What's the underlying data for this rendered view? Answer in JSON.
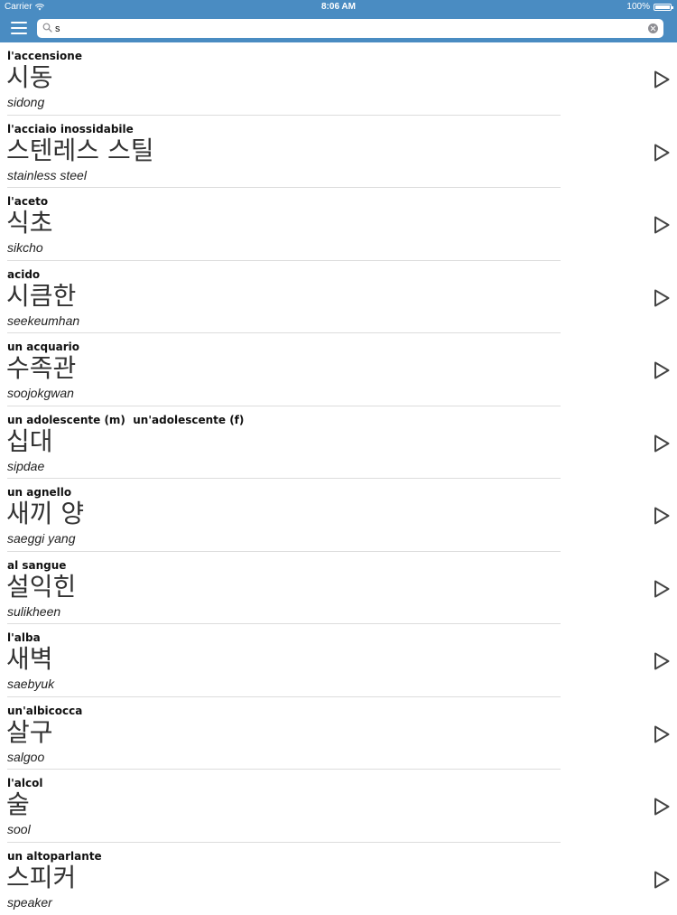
{
  "status_bar": {
    "carrier": "Carrier",
    "time": "8:06 AM",
    "battery": "100%"
  },
  "search": {
    "value": "s",
    "placeholder": ""
  },
  "entries": [
    {
      "italian": "l'accensione",
      "korean": "시동",
      "romanization": "sidong"
    },
    {
      "italian": "l'acciaio inossidabile",
      "korean": "스텐레스 스틸",
      "romanization": "stainless steel"
    },
    {
      "italian": "l'aceto",
      "korean": "식초",
      "romanization": "sikcho"
    },
    {
      "italian": "acido",
      "korean": "시큼한",
      "romanization": "seekeumhan"
    },
    {
      "italian": "un acquario",
      "korean": "수족관",
      "romanization": "soojokgwan"
    },
    {
      "italian": "un adolescente (m)  un'adolescente (f)",
      "korean": "십대",
      "romanization": "sipdae"
    },
    {
      "italian": "un agnello",
      "korean": "새끼 양",
      "romanization": "saeggi yang"
    },
    {
      "italian": "al sangue",
      "korean": "설익힌",
      "romanization": "sulikheen"
    },
    {
      "italian": "l'alba",
      "korean": "새벽",
      "romanization": "saebyuk"
    },
    {
      "italian": "un'albicocca",
      "korean": "살구",
      "romanization": "salgoo"
    },
    {
      "italian": "l'alcol",
      "korean": "술",
      "romanization": "sool"
    },
    {
      "italian": "un altoparlante",
      "korean": "스피커",
      "romanization": "speaker"
    }
  ],
  "colors": {
    "bar": "#4a8cc2",
    "separator": "#dcdcdc"
  },
  "icons": {
    "menu": "hamburger-menu-icon",
    "search": "magnifier-icon",
    "clear": "clear-x-icon",
    "play": "play-triangle-icon"
  }
}
